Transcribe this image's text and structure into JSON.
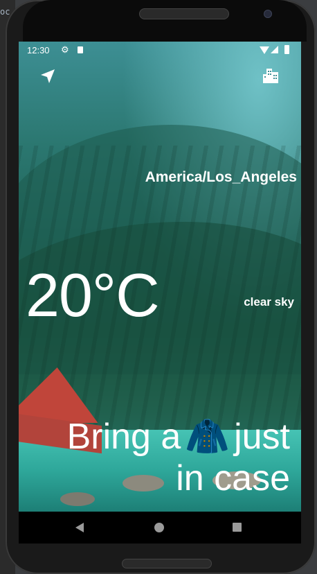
{
  "status_bar": {
    "time": "12:30",
    "icons": [
      "settings-icon",
      "sd-card-icon",
      "wifi-icon",
      "signal-icon",
      "battery-icon"
    ]
  },
  "header": {
    "left_icon": "navigation-arrow-icon",
    "right_icon": "city-buildings-icon"
  },
  "weather": {
    "timezone": "America/Los_Angeles",
    "temperature": "20°C",
    "condition": "clear sky"
  },
  "advice": {
    "prefix": "Bring a",
    "emoji": "🧥",
    "middle": "just",
    "suffix": "in case"
  },
  "nav_bar": {
    "icons": [
      "back-icon",
      "home-icon",
      "recent-apps-icon"
    ]
  },
  "colors": {
    "text": "#ffffff",
    "sky_accent": "#6fc1c6",
    "forest": "#1f6357",
    "lake": "#36a39a",
    "cabin_roof": "#c0453a",
    "nav_bar": "#000000"
  }
}
